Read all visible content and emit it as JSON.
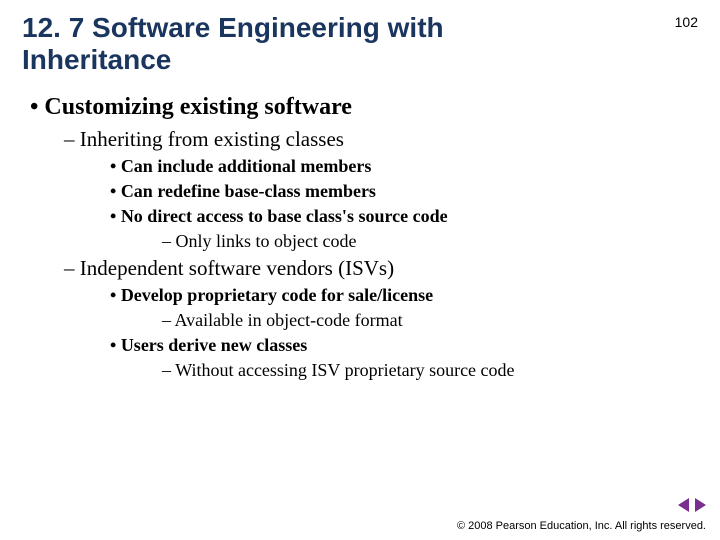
{
  "page_number": "102",
  "title": "12. 7 Software Engineering with Inheritance",
  "bullets": {
    "l1_1": "Customizing existing software",
    "l2_1": "Inheriting from existing classes",
    "l3_1": "Can include additional members",
    "l3_2": "Can redefine base-class members",
    "l3_3": "No direct access to base class's source code",
    "l4_1": "Only links to object code",
    "l2_2": "Independent software vendors (ISVs)",
    "l3_4": "Develop proprietary code for sale/license",
    "l4_2": "Available in object-code format",
    "l3_5": "Users derive new classes",
    "l4_3": "Without accessing ISV proprietary source code"
  },
  "footer": "© 2008 Pearson Education, Inc.  All rights reserved."
}
